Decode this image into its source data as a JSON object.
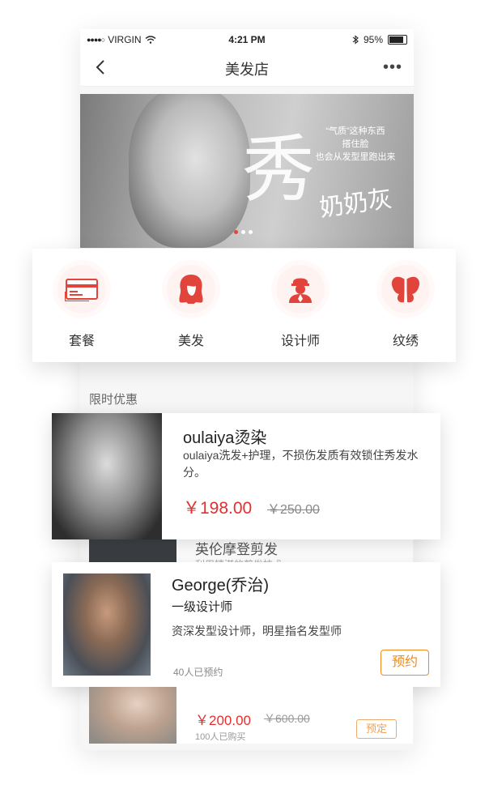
{
  "status_bar": {
    "carrier": "VIRGIN",
    "time": "4:21 PM",
    "battery": "95%",
    "battery_level": 0.95
  },
  "nav": {
    "title": "美发店"
  },
  "banner": {
    "caption": [
      "“气质”这种东西",
      "搭住脸",
      "也会从发型里跑出来"
    ],
    "calligraphy_big": "秀",
    "calligraphy_small": "奶奶灰",
    "pager_count": 3,
    "pager_active": 0
  },
  "categories": [
    {
      "label": "套餐",
      "icon": "package-card-icon"
    },
    {
      "label": "美发",
      "icon": "hair-icon"
    },
    {
      "label": "设计师",
      "icon": "designer-icon"
    },
    {
      "label": "纹绣",
      "icon": "butterfly-icon"
    }
  ],
  "section_title": "限时优惠",
  "deal": {
    "title": "oulaiya烫染",
    "description": "oulaiya洗发+护理，不损伤发质有效锁住秀发水分。",
    "price": "￥198.00",
    "original_price": "￥250.00"
  },
  "behind_item": {
    "title": "英伦摩登剪发",
    "subtitle": "利用精湛的剪发技术"
  },
  "designer": {
    "name": "George(乔治)",
    "level": "一级设计师",
    "description": "资深发型设计师，明星指名发型师",
    "booked": "40人已预约",
    "button": "预约"
  },
  "bottom_item": {
    "price": "￥200.00",
    "original_price": "￥600.00",
    "sold": "100人已购买",
    "button": "预定"
  },
  "colors": {
    "accent_red": "#e52e2e",
    "accent_orange": "#f08a1c"
  }
}
